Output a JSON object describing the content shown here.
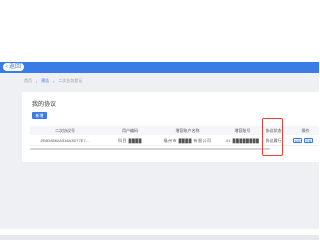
{
  "nav": {
    "back_icon": "chevron-left-icon",
    "back_label": "返回"
  },
  "breadcrumb": {
    "items": [
      "首页",
      "预告",
      "二次业务登记"
    ]
  },
  "page": {
    "title": "我的协议",
    "new_button": "新增"
  },
  "table": {
    "headers": [
      "二次协议号",
      "用户编码",
      "增容账户名称",
      "增容账号",
      "协议状态",
      "操作"
    ],
    "rows": [
      {
        "protocol_no": "2E8D8562A316A3D77E7…",
        "user_code": "科目 ████",
        "account_name": "福州市 ████ 有限公司",
        "account_no": "41 ████████",
        "status": "协议履行",
        "actions": [
          "编辑",
          "查看"
        ]
      }
    ]
  },
  "colors": {
    "accent": "#3b7be8",
    "highlight": "#e8413a",
    "background": "#eef0f4"
  }
}
